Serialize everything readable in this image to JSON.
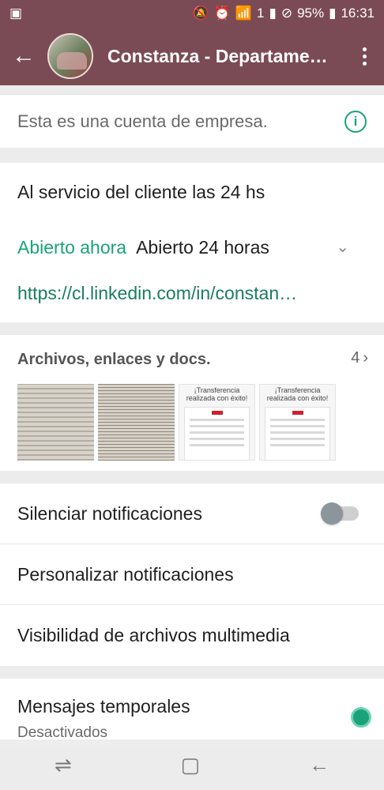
{
  "status_bar": {
    "battery": "95%",
    "time": "16:31",
    "sim": "1"
  },
  "header": {
    "title": "Constanza - Departame…"
  },
  "business_notice": "Esta es una cuenta de empresa.",
  "description": "Al servicio del cliente las 24 hs",
  "hours": {
    "status": "Abierto ahora",
    "value": "Abierto 24 horas"
  },
  "website": "https://cl.linkedin.com/in/constan…",
  "media": {
    "title": "Archivos, enlaces y docs.",
    "count": "4",
    "receipt_heading": "¡Transferencia realizada con éxito!"
  },
  "settings": {
    "mute": "Silenciar notificaciones",
    "custom": "Personalizar notificaciones",
    "visibility": "Visibilidad de archivos multimedia"
  },
  "temporary": {
    "title": "Mensajes temporales",
    "status": "Desactivados"
  },
  "colors": {
    "header": "#7b4b55",
    "accent": "#1aa37a"
  }
}
